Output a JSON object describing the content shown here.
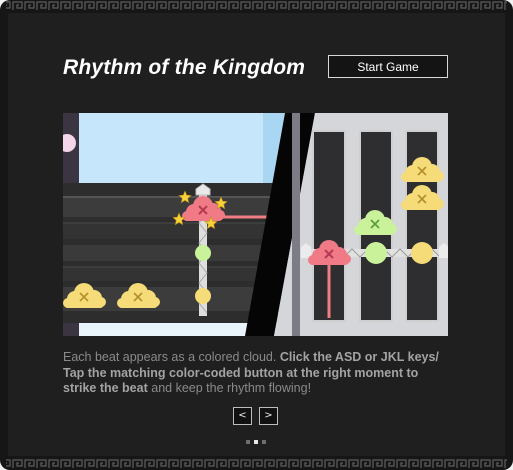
{
  "game": {
    "title": "Rhythm of the Kingdom",
    "start_button": "Start Game"
  },
  "tutorial": {
    "intro_text": "Each beat appears as a colored cloud. ",
    "bold_text": "Click the ASD or JKL keys/ Tap the matching color-coded button at the right moment to strike the beat",
    "outro_text": " and keep the rhythm flowing!"
  },
  "carousel": {
    "prev_label": "<",
    "next_label": ">",
    "slide_count": 3,
    "active_slide": 2
  },
  "colors": {
    "background": "#161616",
    "panel": "#1f1f1f",
    "cloud_red": "#f07a86",
    "cloud_green": "#c9f29a",
    "cloud_yellow": "#f6dc78"
  }
}
